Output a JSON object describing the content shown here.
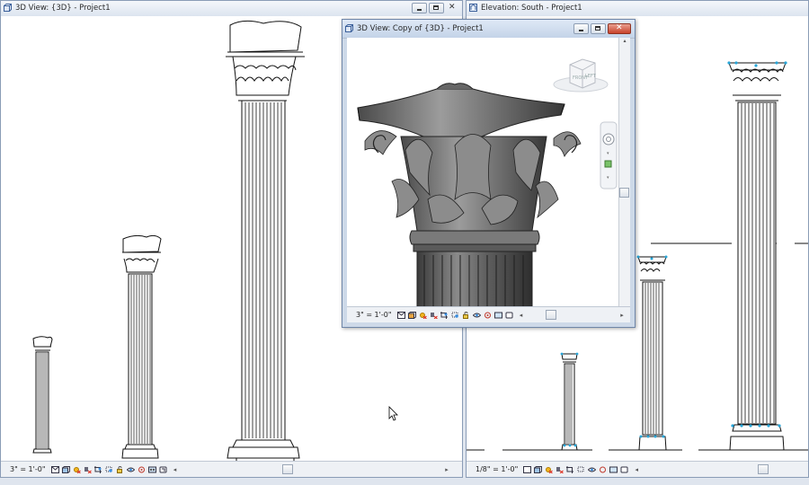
{
  "windows": {
    "left": {
      "title": "3D View: {3D} - Project1",
      "scale": "3\" = 1'-0\""
    },
    "right": {
      "title": "Elevation: South - Project1",
      "scale": "1/8\" = 1'-0\""
    },
    "floating": {
      "title": "3D View: Copy of {3D} - Project1",
      "scale": "3\" = 1'-0\"",
      "viewcube_front": "FRONT",
      "viewcube_left": "LEFT"
    }
  },
  "view_control_icons": [
    "detail-level-icon",
    "visual-style-icon",
    "sun-path-icon",
    "shadows-icon",
    "crop-view-icon",
    "show-crop-icon",
    "unlock-3d-icon",
    "temporary-hide-icon",
    "reveal-hidden-icon",
    "analysis-display-icon",
    "render-icon"
  ],
  "colors": {
    "selection_cyan": "#27a6d9",
    "title_gradient_top": "#f4f7fb",
    "close_red": "#c8412a"
  }
}
